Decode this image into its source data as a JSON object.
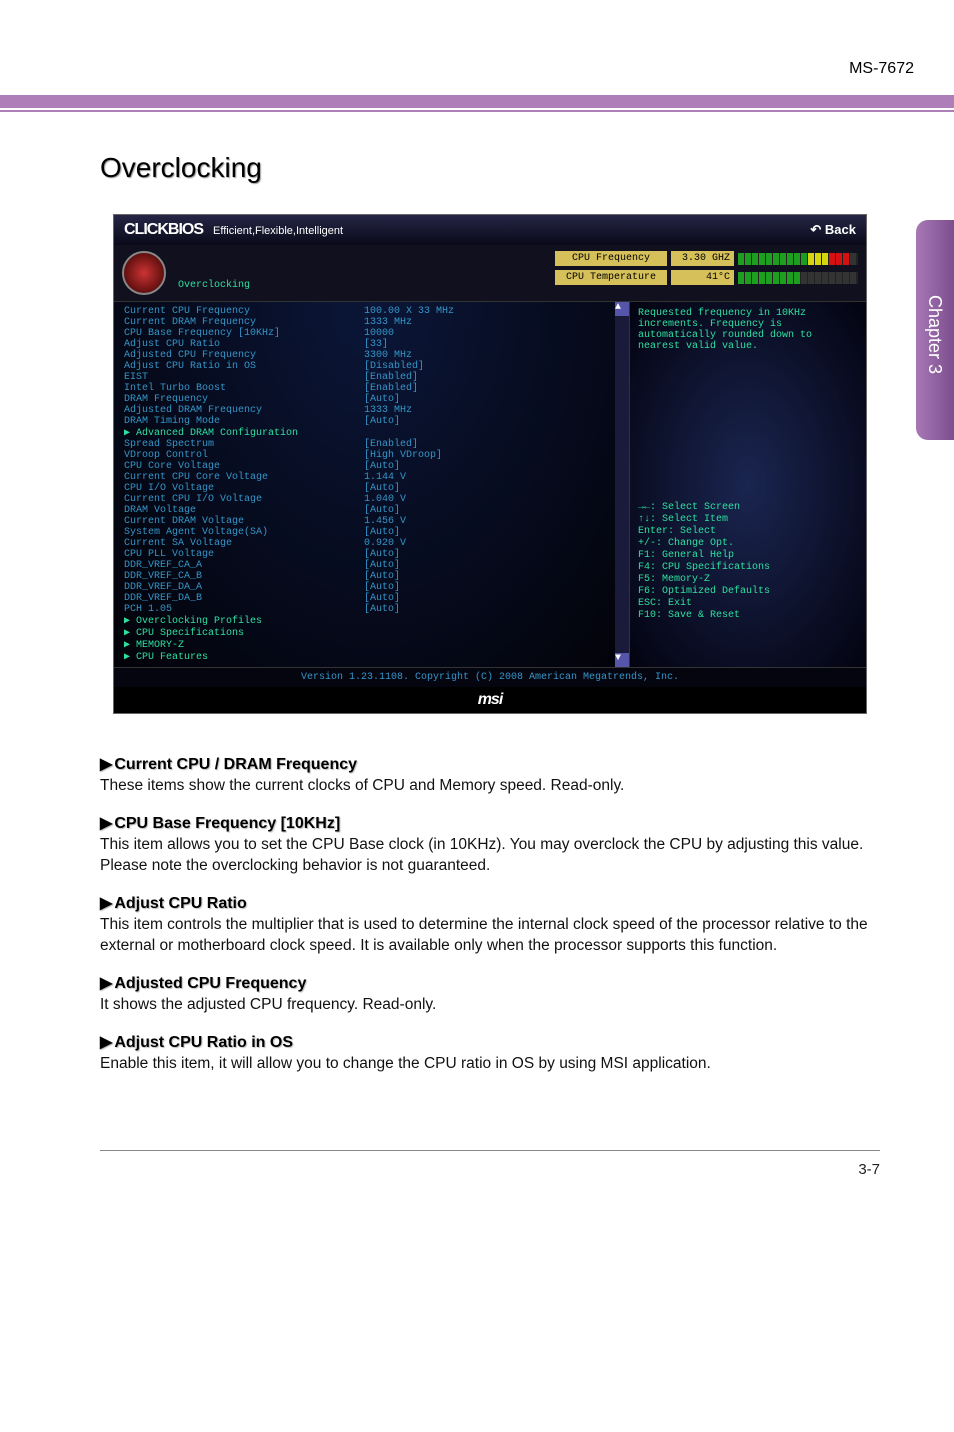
{
  "header": {
    "model": "MS-7672"
  },
  "page": {
    "title": "Overclocking",
    "chapter_tab": "Chapter 3",
    "page_number": "3-7"
  },
  "bios": {
    "logo": "CLICKBIOS",
    "logo_sub": "Efficient,Flexible,Intelligent",
    "back_label": "Back",
    "section_title": "Overclocking",
    "cpu_freq_label": "CPU Frequency",
    "cpu_freq_value": "3.30 GHZ",
    "cpu_temp_label": "CPU Temperature",
    "cpu_temp_value": "41°C",
    "version_line": "Version 1.23.1108. Copyright (C) 2008 American Megatrends, Inc.",
    "footer_logo": "msi"
  },
  "settings": [
    {
      "label": "Current CPU Frequency",
      "value": "100.00 X 33 MHz",
      "c": "cyan"
    },
    {
      "label": "Current DRAM Frequency",
      "value": "1333 MHz",
      "c": "cyan"
    },
    {
      "label": "CPU Base Frequency [10KHz]",
      "value": "10000",
      "c": "cyan"
    },
    {
      "label": "Adjust CPU Ratio",
      "value": "[33]",
      "c": "cyan"
    },
    {
      "label": "Adjusted CPU Frequency",
      "value": "3300 MHz",
      "c": "cyan"
    },
    {
      "label": "Adjust CPU Ratio in OS",
      "value": "[Disabled]",
      "c": "cyan"
    },
    {
      "label": "EIST",
      "value": "[Enabled]",
      "c": "cyan"
    },
    {
      "label": "Intel Turbo Boost",
      "value": "[Enabled]",
      "c": "cyan"
    },
    {
      "label": "DRAM Frequency",
      "value": "[Auto]",
      "c": "cyan"
    },
    {
      "label": "Adjusted DRAM Frequency",
      "value": "1333 MHz",
      "c": "cyan"
    },
    {
      "label": "DRAM Timing Mode",
      "value": "[Auto]",
      "c": "cyan"
    },
    {
      "label": "Advanced DRAM Configuration",
      "value": "",
      "c": "green",
      "tri": true
    },
    {
      "label": "Spread Spectrum",
      "value": "[Enabled]",
      "c": "cyan"
    },
    {
      "label": "VDroop Control",
      "value": "[High VDroop]",
      "c": "cyan"
    },
    {
      "label": "CPU Core Voltage",
      "value": "[Auto]",
      "c": "cyan"
    },
    {
      "label": "Current CPU Core Voltage",
      "value": "1.144 V",
      "c": "cyan"
    },
    {
      "label": "CPU I/O Voltage",
      "value": "[Auto]",
      "c": "cyan"
    },
    {
      "label": "Current CPU I/O Voltage",
      "value": "1.040 V",
      "c": "cyan"
    },
    {
      "label": "DRAM Voltage",
      "value": "[Auto]",
      "c": "cyan"
    },
    {
      "label": "Current DRAM Voltage",
      "value": "1.456 V",
      "c": "cyan"
    },
    {
      "label": "System Agent Voltage(SA)",
      "value": "[Auto]",
      "c": "cyan"
    },
    {
      "label": "Current SA Voltage",
      "value": "0.920 V",
      "c": "cyan"
    },
    {
      "label": "CPU PLL Voltage",
      "value": "[Auto]",
      "c": "cyan"
    },
    {
      "label": "DDR_VREF_CA_A",
      "value": "[Auto]",
      "c": "cyan"
    },
    {
      "label": "DDR_VREF_CA_B",
      "value": "[Auto]",
      "c": "cyan"
    },
    {
      "label": "DDR_VREF_DA_A",
      "value": "[Auto]",
      "c": "cyan"
    },
    {
      "label": "DDR_VREF_DA_B",
      "value": "[Auto]",
      "c": "cyan"
    },
    {
      "label": "PCH 1.05",
      "value": "[Auto]",
      "c": "cyan"
    },
    {
      "label": "Overclocking Profiles",
      "value": "",
      "c": "green",
      "tri": true
    },
    {
      "label": "CPU Specifications",
      "value": "",
      "c": "green",
      "tri": true
    },
    {
      "label": "MEMORY-Z",
      "value": "",
      "c": "green",
      "tri": true
    },
    {
      "label": "CPU Features",
      "value": "",
      "c": "green",
      "tri": true
    }
  ],
  "help_top": "Requested frequency in 10KHz increments. Frequency is automatically rounded down to nearest valid value.",
  "help_keys": [
    "→←: Select Screen",
    "↑↓: Select Item",
    "Enter: Select",
    "+/-: Change Opt.",
    "F1: General Help",
    "F4: CPU Specifications",
    "F5: Memory-Z",
    "F6: Optimized Defaults",
    "ESC: Exit",
    "F10: Save & Reset"
  ],
  "descriptions": [
    {
      "h": "Current CPU / DRAM Frequency",
      "p": "These items show the current clocks of CPU and Memory speed. Read-only."
    },
    {
      "h": "CPU Base Frequency [10KHz]",
      "p": "This item allows you to set the CPU Base clock (in 10KHz). You may overclock the CPU by adjusting this value. Please note the overclocking behavior is not guaranteed."
    },
    {
      "h": "Adjust CPU Ratio",
      "p": "This item controls the multiplier that is used to determine the internal clock speed of the processor relative to the external or motherboard clock speed. It is available only when the processor supports this function."
    },
    {
      "h": "Adjusted CPU Frequency",
      "p": "It shows the adjusted CPU frequency. Read-only."
    },
    {
      "h": "Adjust CPU Ratio in OS",
      "p": "Enable this item, it will allow you to change the CPU ratio in OS by using MSI application."
    }
  ]
}
